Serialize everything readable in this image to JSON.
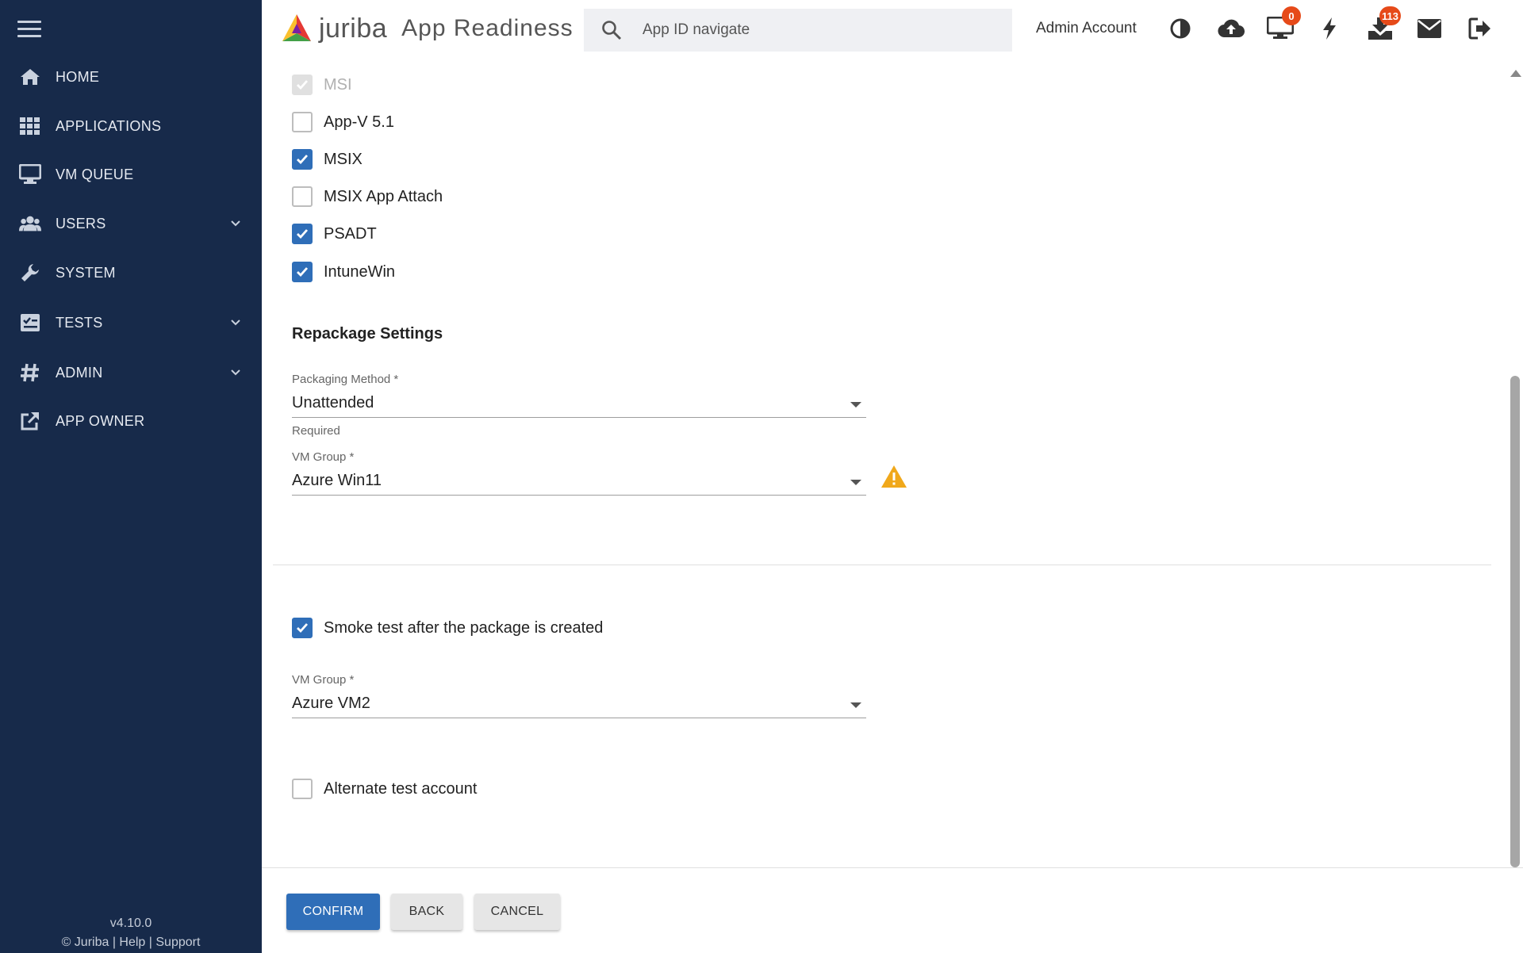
{
  "sidebar": {
    "items": [
      {
        "label": "HOME",
        "icon": "home-icon"
      },
      {
        "label": "APPLICATIONS",
        "icon": "grid-icon"
      },
      {
        "label": "VM QUEUE",
        "icon": "monitor-icon"
      },
      {
        "label": "USERS",
        "icon": "users-icon"
      },
      {
        "label": "SYSTEM",
        "icon": "wrench-icon"
      },
      {
        "label": "TESTS",
        "icon": "checklist-icon"
      },
      {
        "label": "ADMIN",
        "icon": "hash-icon"
      },
      {
        "label": "APP OWNER",
        "icon": "external-link-icon"
      }
    ],
    "version": "v4.10.0",
    "footer": {
      "copyright": "© Juriba",
      "sep1": " | ",
      "help": "Help",
      "sep2": " | ",
      "support": "Support"
    }
  },
  "header": {
    "brand": "juriba",
    "app_name": "App Readiness",
    "search_placeholder": "App ID navigate",
    "account": "Admin Account",
    "vm_badge": "0",
    "download_badge": "113"
  },
  "formats": [
    {
      "label": "MSI",
      "checked": true,
      "disabled": true
    },
    {
      "label": "App-V 5.1",
      "checked": false,
      "disabled": false
    },
    {
      "label": "MSIX",
      "checked": true,
      "disabled": false
    },
    {
      "label": "MSIX App Attach",
      "checked": false,
      "disabled": false
    },
    {
      "label": "PSADT",
      "checked": true,
      "disabled": false
    },
    {
      "label": "IntuneWin",
      "checked": true,
      "disabled": false
    }
  ],
  "repackage": {
    "title": "Repackage Settings",
    "packaging_method": {
      "label": "Packaging Method *",
      "value": "Unattended",
      "hint": "Required"
    },
    "vm_group": {
      "label": "VM Group *",
      "value": "Azure Win11"
    }
  },
  "smoke_test": {
    "label": "Smoke test after the package is created",
    "checked": true,
    "vm_group": {
      "label": "VM Group *",
      "value": "Azure VM2"
    }
  },
  "alternate_account": {
    "label": "Alternate test account",
    "checked": false
  },
  "actions": {
    "confirm": "CONFIRM",
    "back": "BACK",
    "cancel": "CANCEL"
  },
  "colors": {
    "sidebar": "#172a4a",
    "primary": "#2f6eb8",
    "badge": "#e64a19",
    "warning": "#f0a81b"
  }
}
